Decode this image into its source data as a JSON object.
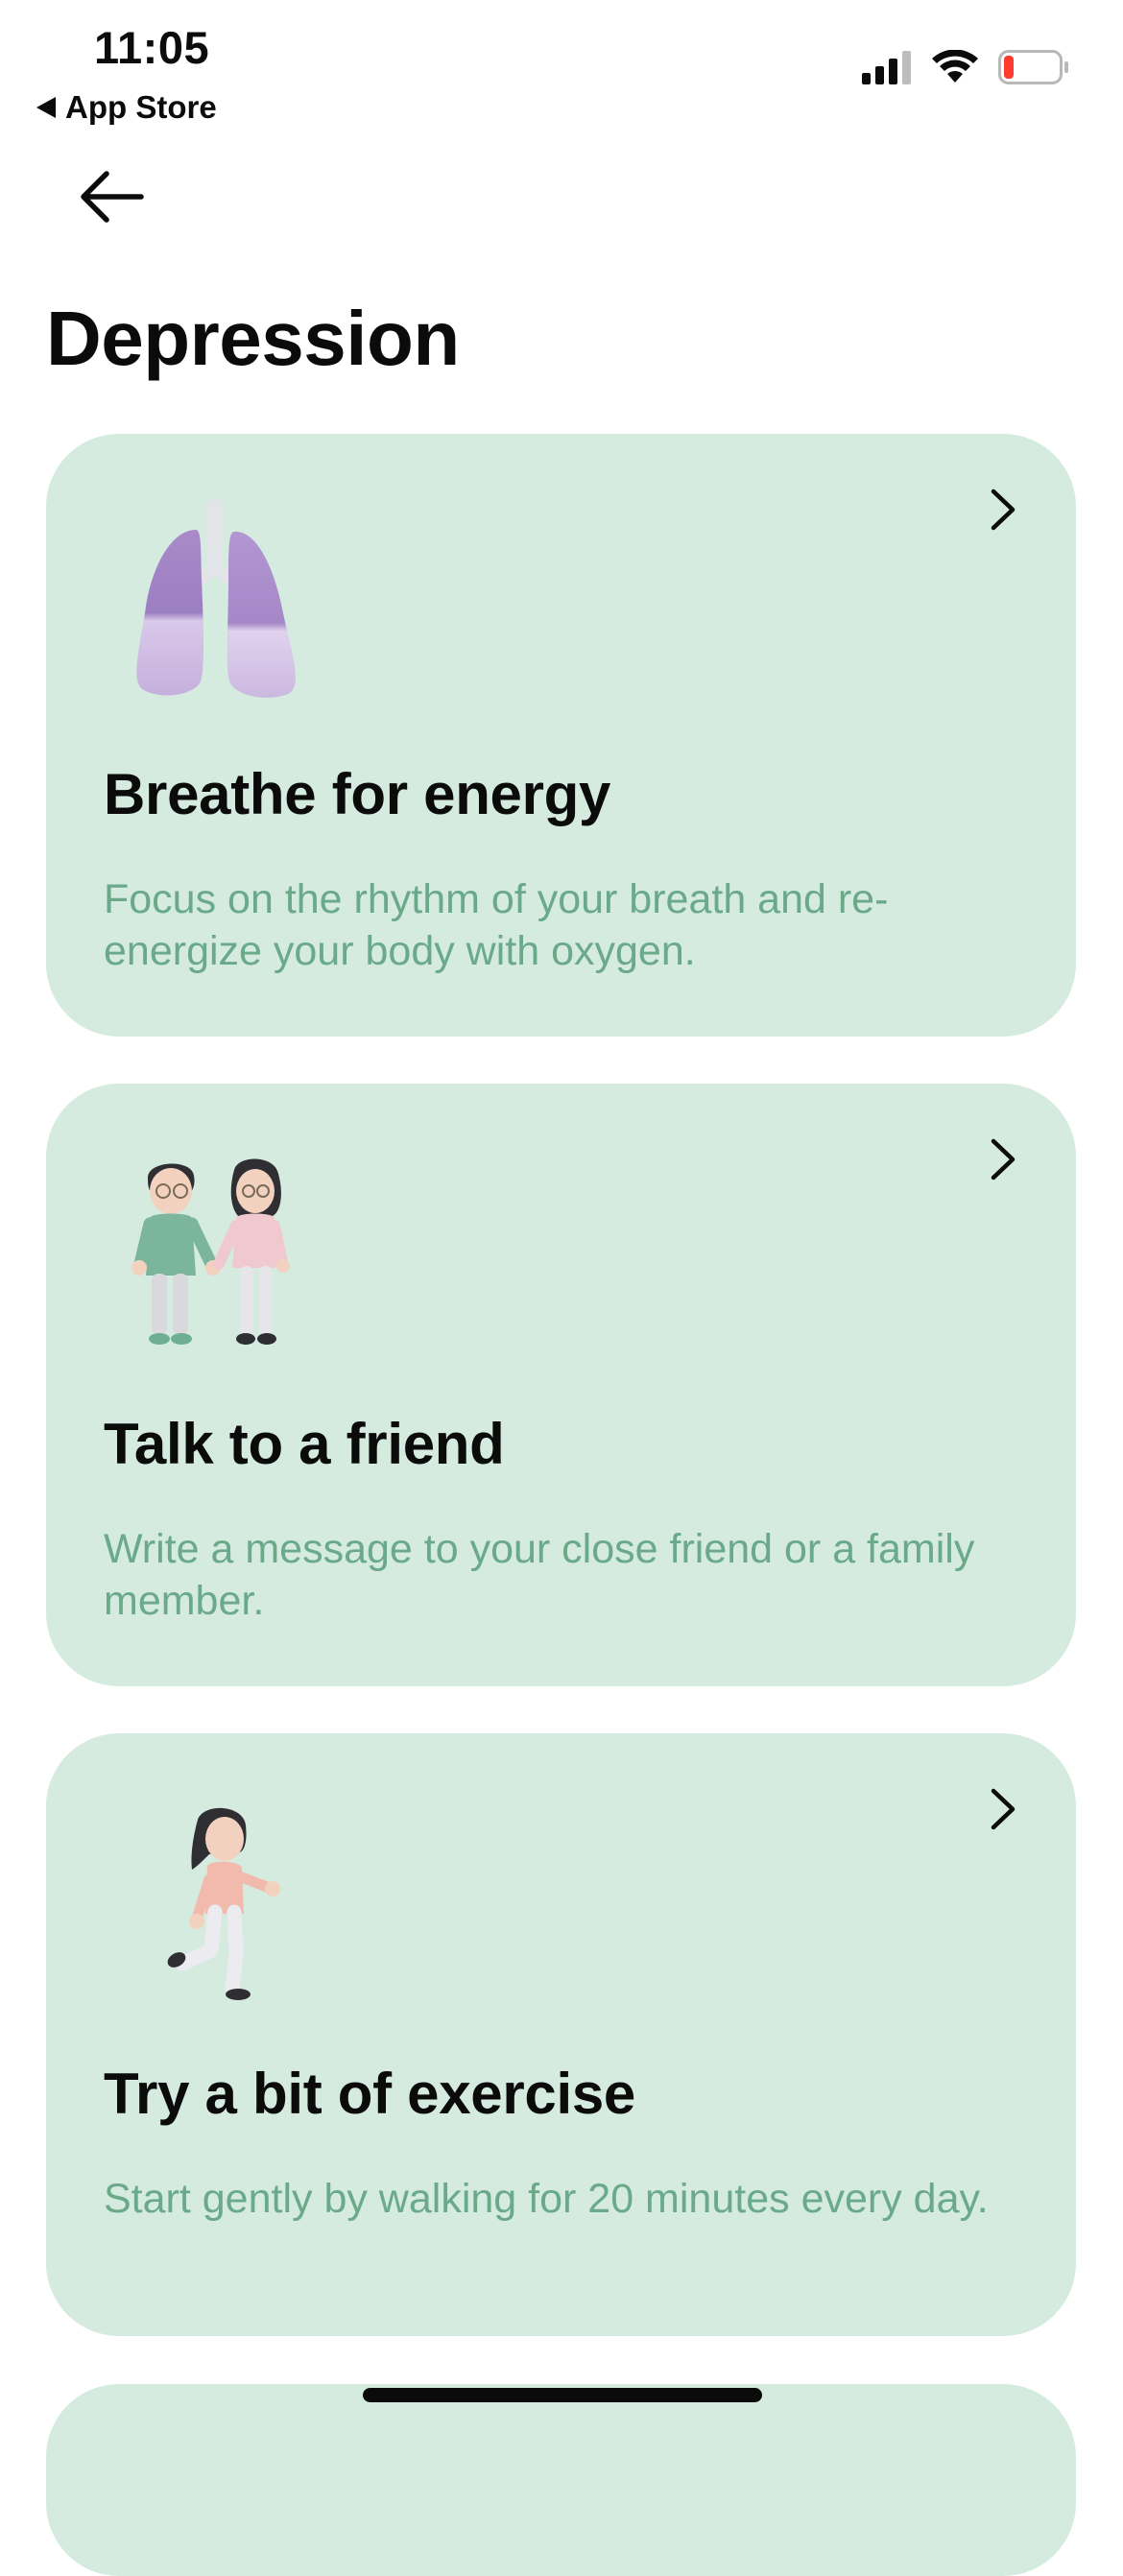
{
  "status_bar": {
    "time": "11:05",
    "back_app_label": "App Store",
    "signal_icon": "cellular-signal-icon",
    "wifi_icon": "wifi-icon",
    "battery_icon": "battery-low-icon",
    "battery_level_color": "#ff3b30"
  },
  "nav": {
    "back_icon": "arrow-left-icon"
  },
  "page": {
    "title": "Depression"
  },
  "cards": [
    {
      "title": "Breathe for energy",
      "description": "Focus on the rhythm of your breath and re-energize your body with oxygen.",
      "illustration": "lungs-illustration"
    },
    {
      "title": "Talk to a friend",
      "description": "Write a message to your close friend or a family member.",
      "illustration": "two-friends-holding-hands-illustration"
    },
    {
      "title": "Try a bit of exercise",
      "description": "Start gently by walking for 20 minutes every day.",
      "illustration": "girl-running-illustration"
    }
  ],
  "colors": {
    "card_background": "#d5ebe0",
    "description_text": "#6aa98a",
    "title_text": "#0b0b0b"
  }
}
